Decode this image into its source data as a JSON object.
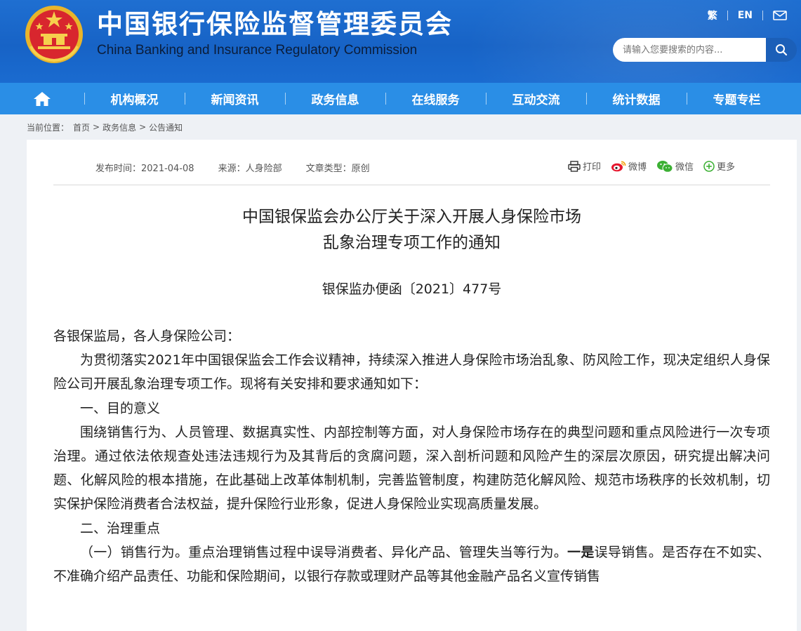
{
  "header": {
    "title_cn": "中国银行保险监督管理委员会",
    "title_en": "China Banking and Insurance Regulatory Commission",
    "links": [
      "繁",
      "EN"
    ],
    "search_placeholder": "请输入您要搜索的内容..."
  },
  "nav": {
    "items": [
      "机构概况",
      "新闻资讯",
      "政务信息",
      "在线服务",
      "互动交流",
      "统计数据",
      "专题专栏"
    ]
  },
  "breadcrumb": {
    "label": "当前位置：",
    "items": [
      "首页",
      "政务信息",
      "公告通知"
    ],
    "sep": ">"
  },
  "article": {
    "publish": "发布时间：2021-04-08",
    "source": "来源：人身险部",
    "type": "文章类型：原创",
    "share": [
      "打印",
      "微博",
      "微信",
      "更多"
    ],
    "title_line1": "中国银保监会办公厅关于深入开展人身保险市场",
    "title_line2": "乱象治理专项工作的通知",
    "doc_number": "银保监办便函〔2021〕477号",
    "salutation": "各银保监局，各人身保险公司：",
    "p1": "为贯彻落实2021年中国银保监会工作会议精神，持续深入推进人身保险市场治乱象、防风险工作，现决定组织人身保险公司开展乱象治理专项工作。现将有关安排和要求通知如下：",
    "h1": "一、目的意义",
    "p2": "围绕销售行为、人员管理、数据真实性、内部控制等方面，对人身保险市场存在的典型问题和重点风险进行一次专项治理。通过依法依规查处违法违规行为及其背后的贪腐问题，深入剖析问题和风险产生的深层次原因，研究提出解决问题、化解风险的根本措施，在此基础上改革体制机制，完善监管制度，构建防范化解风险、规范市场秩序的长效机制，切实保护保险消费者合法权益，提升保险行业形象，促进人身保险业实现高质量发展。",
    "h2": "二、治理重点",
    "p3_a": "（一）销售行为。重点治理销售过程中误导消费者、异化产品、管理失当等行为。",
    "p3_b": "一是",
    "p3_c": "误导销售。是否存在不如实、不准确介绍产品责任、功能和保险期间，以银行存款或理财产品等其他金融产品名义宣传销售"
  },
  "colors": {
    "header_bg": "#1763c6",
    "nav_bg": "#2a8ee6",
    "page_bg": "#eef1f5"
  }
}
